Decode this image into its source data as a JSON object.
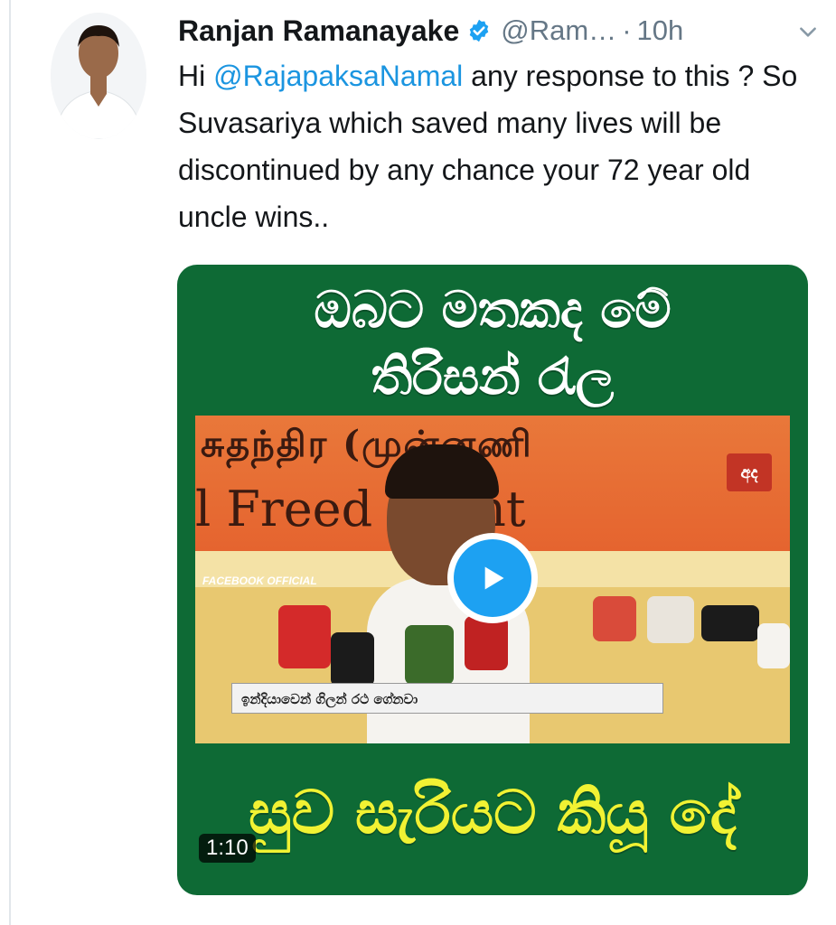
{
  "tweet": {
    "author_name": "Ranjan Ramanayake",
    "handle": "@Ram…",
    "separator": "·",
    "time": "10h",
    "text_before": "Hi ",
    "mention": "@RajapaksaNamal",
    "text_after": " any response to this ? So Suvasariya which saved many lives will be discontinued by any chance your 72 year old uncle wins.."
  },
  "icons": {
    "verified": "verified-badge-icon",
    "caret": "chevron-down-icon",
    "play": "play-icon"
  },
  "colors": {
    "link": "#1b95e0",
    "verified": "#1da1f2",
    "video_bg": "#0e6a35",
    "sinhala_bottom": "#f1f233"
  },
  "video": {
    "top_line_1": "ඔබට මතකද මේ",
    "top_line_2": "තිරිසන් රැල",
    "bottom_line": "සුව සැරියට කියූ දේ",
    "banner_tamil": "சுதந்திர (முன்னணி",
    "banner_english": "l Freed     Front",
    "facebook_label": "FACEBOOK OFFICIAL",
    "caption": "ඉන්දියාවෙන් ගිලන් රථ ගේනවා",
    "duration": "1:10"
  }
}
